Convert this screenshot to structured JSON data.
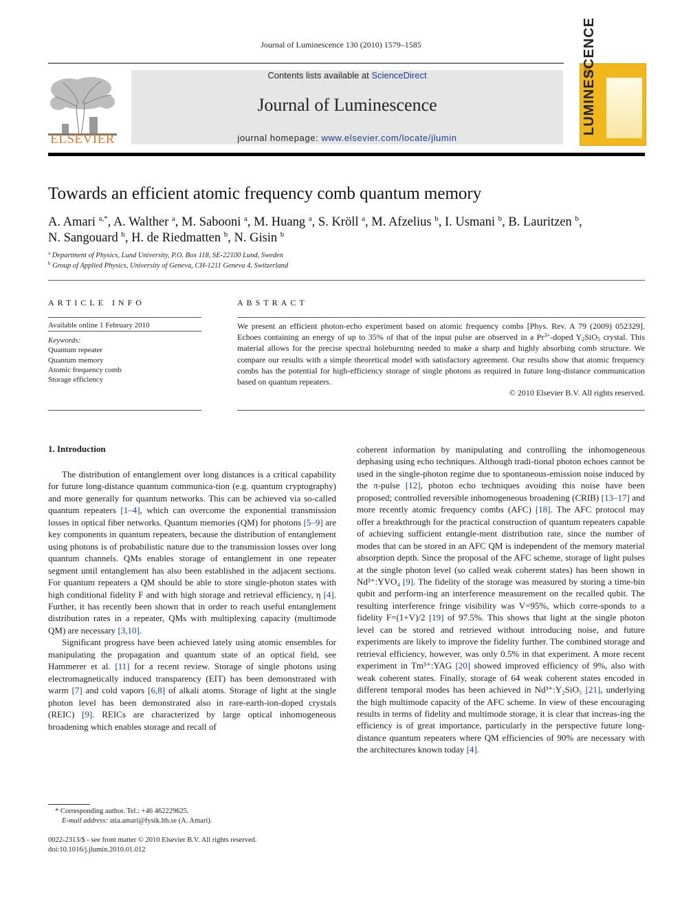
{
  "header": {
    "citation": "Journal of Luminescence 130 (2010) 1579–1585",
    "contents_prefix": "Contents lists available at ",
    "contents_link": "ScienceDirect",
    "journal_title": "Journal of Luminescence",
    "homepage_prefix": "journal homepage: ",
    "homepage_link": "www.elsevier.com/locate/jlumin",
    "publisher_logo_text": "ELSEVIER",
    "cover_text": "LUMINESCENCE",
    "colors": {
      "publisher_orange": "#e87722",
      "link_blue": "#1d3a8a",
      "cover_yellow": "#f1b71c",
      "masthead_gray": "#e6e6e6"
    }
  },
  "article": {
    "title": "Towards an efficient atomic frequency comb quantum memory",
    "authors": [
      {
        "name": "A. Amari",
        "aff": "a,*"
      },
      {
        "name": "A. Walther",
        "aff": "a"
      },
      {
        "name": "M. Sabooni",
        "aff": "a"
      },
      {
        "name": "M. Huang",
        "aff": "a"
      },
      {
        "name": "S. Kröll",
        "aff": "a"
      },
      {
        "name": "M. Afzelius",
        "aff": "b"
      },
      {
        "name": "I. Usmani",
        "aff": "b"
      },
      {
        "name": "B. Lauritzen",
        "aff": "b"
      },
      {
        "name": "N. Sangouard",
        "aff": "b"
      },
      {
        "name": "H. de Riedmatten",
        "aff": "b"
      },
      {
        "name": "N. Gisin",
        "aff": "b"
      }
    ],
    "affiliations": [
      {
        "mark": "a",
        "text": "Department of Physics, Lund University, P.O. Box 118, SE-22100 Lund, Sweden"
      },
      {
        "mark": "b",
        "text": "Group of Applied Physics, University of Geneva, CH-1211 Geneva 4, Switzerland"
      }
    ]
  },
  "article_info": {
    "heading": "ARTICLE INFO",
    "available": "Available online 1 February 2010",
    "keywords_label": "Keywords:",
    "keywords": [
      "Quantum repeater",
      "Quantum memory",
      "Atomic frequency comb",
      "Storage efficiency"
    ]
  },
  "abstract": {
    "heading": "ABSTRACT",
    "p1": "We present an efficient photon-echo experiment based on atomic frequency combs [Phys. Rev. A 79 (2009) 052329]. Echoes containing an energy of up to 35% of that of the input pulse are observed in a Pr",
    "p1_sup": "3+",
    "p1b": "-doped Y",
    "p1_sub1": "2",
    "p1c": "SiO",
    "p1_sub2": "5",
    "p1d": " crystal. This material allows for the precise spectral holeburning needed to make a sharp and highly absorbing comb structure. We compare our results with a simple theoretical model with satisfactory agreement. Our results show that atomic frequency combs has the potential for high-efficiency storage of single photons as required in future long-distance communication based on quantum repeaters.",
    "copyright": "© 2010 Elsevier B.V. All rights reserved."
  },
  "intro": {
    "heading": "1.  Introduction",
    "left": [
      [
        "The distribution of entanglement over long distances is a critical capability for future long-distance quantum communica-tion (e.g. quantum cryptography) and more generally for quantum networks. This can be achieved via so-called quantum repeaters ",
        "[1–4]",
        ", which can overcome the exponential transmission losses in optical fiber networks. Quantum memories (QM) for photons ",
        "[5–9]",
        " are key components in quantum repeaters, because the distribution of entanglement using photons is of probabilistic nature due to the transmission losses over long quantum channels. QMs enables storage of entanglement in one repeater segment until entanglement has also been established in the adjacent sections. For quantum repeaters a QM should be able to store single-photon states with high conditional fidelity F and with high storage and retrieval efficiency, η ",
        "[4]",
        ". Further, it has recently been shown that in order to reach useful entanglement distribution rates in a repeater, QMs with multiplexing capacity (multimode QM) are necessary ",
        "[3,10]",
        "."
      ],
      [
        "Significant progress have been achieved lately using atomic ensembles for manipulating the propagation and quantum state of an optical field, see Hammerer et al. ",
        "[11]",
        " for a recent review. Storage of single photons using electromagnetically induced transparency (EIT) has been demonstrated with warm ",
        "[7]",
        " and cold vapors ",
        "[6,8]",
        " of alkali atoms. Storage of light at the single photon level has been demonstrated also in rare-earth-ion-doped crystals (REIC) ",
        "[9]",
        ". REICs are characterized by large optical inhomogeneous broadening which enables storage and recall of"
      ]
    ],
    "right": [
      "coherent information by manipulating and controlling the inhomogeneous dephasing using echo techniques. Although tradi-tional photon echoes cannot be used in the single-photon regime due to spontaneous-emission noise induced by the π-pulse ",
      "[12]",
      ", photon echo techniques avoiding this noise have been proposed; controlled reversible inhomogeneous broadening (CRIB) ",
      "[13–17]",
      " and more recently atomic frequency combs (AFC) ",
      "[18]",
      ". The AFC protocol may offer a breakthrough for the practical construction of quantum repeaters capable of achieving sufficient entangle-ment distribution rate, since the number of modes that can be stored in an AFC QM is independent of the memory material absorption depth. Since the proposal of the AFC scheme, storage of light pulses at the single photon level (so called weak coherent states) has been shown in Nd³⁺:YVO₄ ",
      "[9]",
      ". The fidelity of the storage was measured by storing a time-bin qubit and perform-ing an interference measurement on the recalled qubit. The resulting interference fringe visibility was V=95%, which corre-sponds to a fidelity F=(1+V)/2 ",
      "[19]",
      " of 97.5%. This shows that light at the single photon level can be stored and retrieved without introducing noise, and future experiments are likely to improve the fidelity further. The combined storage and retrieval efficiency, however, was only 0.5% in that experiment. A more recent experiment in Tm³⁺:YAG ",
      "[20]",
      " showed improved efficiency of 9%, also with weak coherent states. Finally, storage of 64 weak coherent states encoded in different temporal modes has been achieved in Nd³⁺:Y₂SiO₅ ",
      "[21]",
      ", underlying the high multimode capacity of the AFC scheme. In view of these encouraging results in terms of fidelity and multimode storage, it is clear that increas-ing the efficiency is of great importance, particularly in the perspective future long-distance quantum repeaters where QM efficiencies of 90% are necessary with the architectures known today ",
      "[4]",
      "."
    ]
  },
  "footnotes": {
    "corresponding": "* Corresponding author. Tel.: +46 462229625.",
    "email_label": "E-mail address:",
    "email": " atia.amari@fysik.lth.se (A. Amari).",
    "front_matter": "0022-2313/$ - see front matter © 2010 Elsevier B.V. All rights reserved.",
    "doi": "doi:10.1016/j.jlumin.2010.01.012"
  }
}
